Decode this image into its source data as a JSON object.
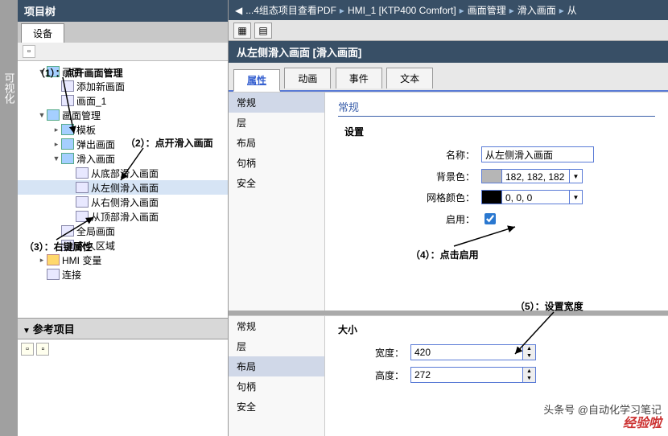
{
  "leftrail": {
    "label": "可视化"
  },
  "leftpanel": {
    "title": "项目树",
    "tab": "设备",
    "tree": {
      "screen_folder": "画面",
      "add_screen": "添加新画面",
      "screen_1": "画面_1",
      "screen_mgmt": "画面管理",
      "templates": "模板",
      "popup": "弹出画面",
      "slidein": "滑入画面",
      "slide_bottom": "从底部滑入画面",
      "slide_left": "从左侧滑入画面",
      "slide_right": "从右侧滑入画面",
      "slide_top": "从顶部滑入画面",
      "global": "全局画面",
      "perm": "永久区域",
      "hmi_tags": "HMI 变量",
      "conn": "连接"
    },
    "ref_title": "参考项目"
  },
  "breadcrumb": {
    "prev": "...4组态项目查看PDF",
    "hmi": "HMI_1 [KTP400 Comfort]",
    "mgmt": "画面管理",
    "slide": "滑入画面",
    "from": "从"
  },
  "titlebar": "从左侧滑入画面 [滑入画面]",
  "tabs": {
    "props": "属性",
    "anim": "动画",
    "events": "事件",
    "text": "文本"
  },
  "cats": {
    "general": "常规",
    "layer": "层",
    "layout": "布局",
    "handle": "句柄",
    "security": "安全"
  },
  "general": {
    "heading": "常规",
    "settings": "设置",
    "name_l": "名称：",
    "name_v": "从左侧滑入画面",
    "bg_l": "背景色：",
    "bg_v": "182, 182, 182",
    "grid_l": "网格颜色：",
    "grid_v": "0, 0, 0",
    "enable_l": "启用："
  },
  "layout": {
    "heading": "大小",
    "width_l": "宽度：",
    "width_v": "420",
    "height_l": "高度：",
    "height_v": "272"
  },
  "annot": {
    "a1": "（1）：点开画面管理",
    "a2": "（2）：点开滑入画面",
    "a3": "（3）：右键属性",
    "a4": "（4）：点击启用",
    "a5": "（5）：设置宽度"
  },
  "credit": "头条号 @自动化学习笔记",
  "watermark": "经验啦"
}
